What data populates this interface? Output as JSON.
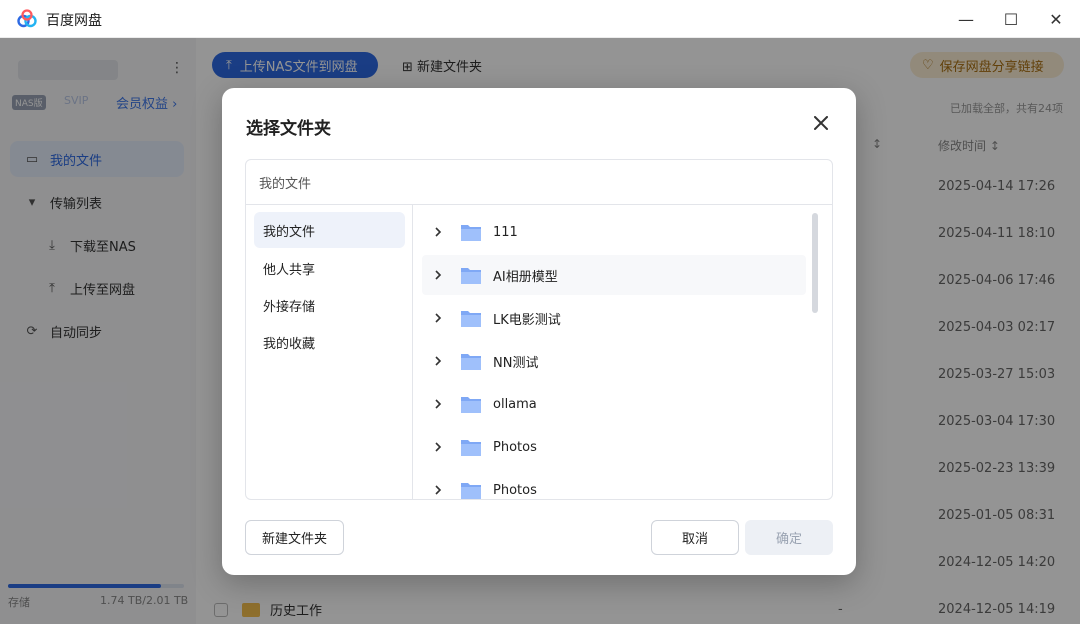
{
  "window": {
    "title": "百度网盘",
    "controls": {
      "minimize": "—",
      "maximize": "☐",
      "close": "✕"
    }
  },
  "sidebar": {
    "badge_nas": "NAS版",
    "badge_level": "SVIP",
    "vip_link": "会员权益 ›",
    "items": [
      {
        "label": "我的文件",
        "icon": "folder-icon"
      },
      {
        "label": "传输列表",
        "icon": "caret-down-icon"
      },
      {
        "label": "下载至NAS",
        "icon": "download-icon"
      },
      {
        "label": "上传至网盘",
        "icon": "upload-icon"
      },
      {
        "label": "自动同步",
        "icon": "sync-icon"
      }
    ],
    "storage": {
      "label": "存储",
      "value": "1.74 TB/2.01 TB",
      "used_fraction": 0.87
    }
  },
  "toolbar": {
    "upload_label": "上传NAS文件到网盘",
    "new_folder_label": "新建文件夹",
    "save_share_label": "保存网盘分享链接"
  },
  "file_table": {
    "loaded_text": "已加载全部，共有24项",
    "size_header": "↕",
    "time_header": "修改时间",
    "times": [
      "2025-04-14 17:26",
      "2025-04-11 18:10",
      "2025-04-06 17:46",
      "2025-04-03 02:17",
      "2025-03-27 15:03",
      "2025-03-04 17:30",
      "2025-02-23 13:39",
      "2025-01-05 08:31",
      "2024-12-05 14:20",
      "2024-12-05 14:19"
    ],
    "bottom_row": {
      "name": "历史工作",
      "size": "-"
    }
  },
  "dialog": {
    "title": "选择文件夹",
    "path": "我的文件",
    "categories": [
      "我的文件",
      "他人共享",
      "外接存储",
      "我的收藏"
    ],
    "folders": [
      "111",
      "AI相册模型",
      "LK电影测试",
      "NN测试",
      "ollama",
      "Photos",
      "Photos"
    ],
    "buttons": {
      "new_folder": "新建文件夹",
      "cancel": "取消",
      "ok": "确定"
    }
  }
}
